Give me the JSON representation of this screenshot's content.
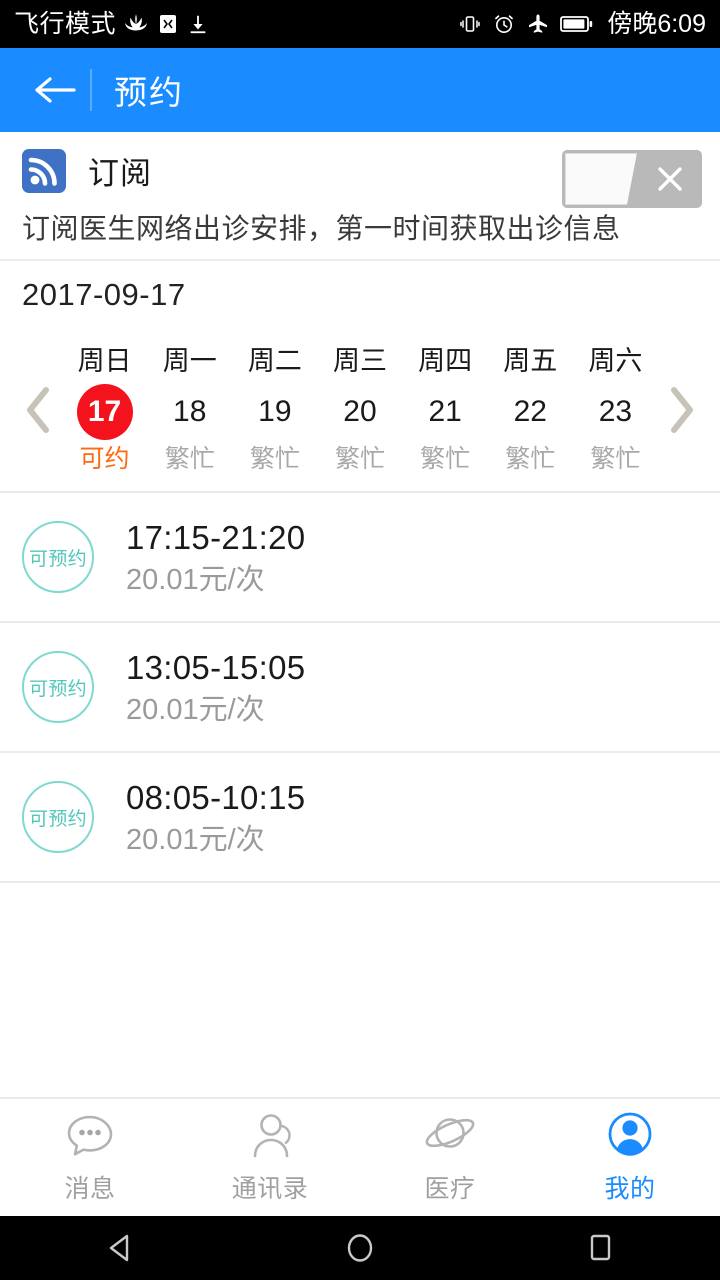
{
  "status_bar": {
    "carrier_text": "飞行模式",
    "time": "傍晚6:09",
    "icons": [
      "huawei-logo-icon",
      "app-badge-icon",
      "download-icon",
      "vibrate-icon",
      "alarm-icon",
      "airplane-icon",
      "battery-icon"
    ]
  },
  "header": {
    "title": "预约",
    "back_icon": "back-arrow-icon",
    "background": "#1a8cff"
  },
  "subscribe": {
    "icon": "rss-icon",
    "label": "订阅",
    "description": "订阅医生网络出诊安排，第一时间获取出诊信息",
    "toggle": {
      "state": "off",
      "mark": "✕"
    }
  },
  "calendar": {
    "date_label": "2017-09-17",
    "prev_icon": "chevron-left-icon",
    "next_icon": "chevron-right-icon",
    "selected_color": "#f4121d",
    "available_color": "#ff6a11",
    "busy_color": "#a8a8a8",
    "days": [
      {
        "dow": "周日",
        "num": "17",
        "state": "可约",
        "selected": true
      },
      {
        "dow": "周一",
        "num": "18",
        "state": "繁忙",
        "selected": false
      },
      {
        "dow": "周二",
        "num": "19",
        "state": "繁忙",
        "selected": false
      },
      {
        "dow": "周三",
        "num": "20",
        "state": "繁忙",
        "selected": false
      },
      {
        "dow": "周四",
        "num": "21",
        "state": "繁忙",
        "selected": false
      },
      {
        "dow": "周五",
        "num": "22",
        "state": "繁忙",
        "selected": false
      },
      {
        "dow": "周六",
        "num": "23",
        "state": "繁忙",
        "selected": false
      }
    ]
  },
  "slots": [
    {
      "badge": "可预约",
      "time": "17:15-21:20",
      "price": "20.01元/次"
    },
    {
      "badge": "可预约",
      "time": "13:05-15:05",
      "price": "20.01元/次"
    },
    {
      "badge": "可预约",
      "time": "08:05-10:15",
      "price": "20.01元/次"
    }
  ],
  "slot_badge_color": "#52c7bb",
  "tabs": [
    {
      "label": "消息",
      "icon": "chat-bubble-icon",
      "active": false
    },
    {
      "label": "通讯录",
      "icon": "contacts-person-icon",
      "active": false
    },
    {
      "label": "医疗",
      "icon": "planet-medical-icon",
      "active": false
    },
    {
      "label": "我的",
      "icon": "profile-person-circle-icon",
      "active": true
    }
  ],
  "nav_bar": {
    "back": "android-back-icon",
    "home": "android-home-icon",
    "recents": "android-recents-icon"
  }
}
